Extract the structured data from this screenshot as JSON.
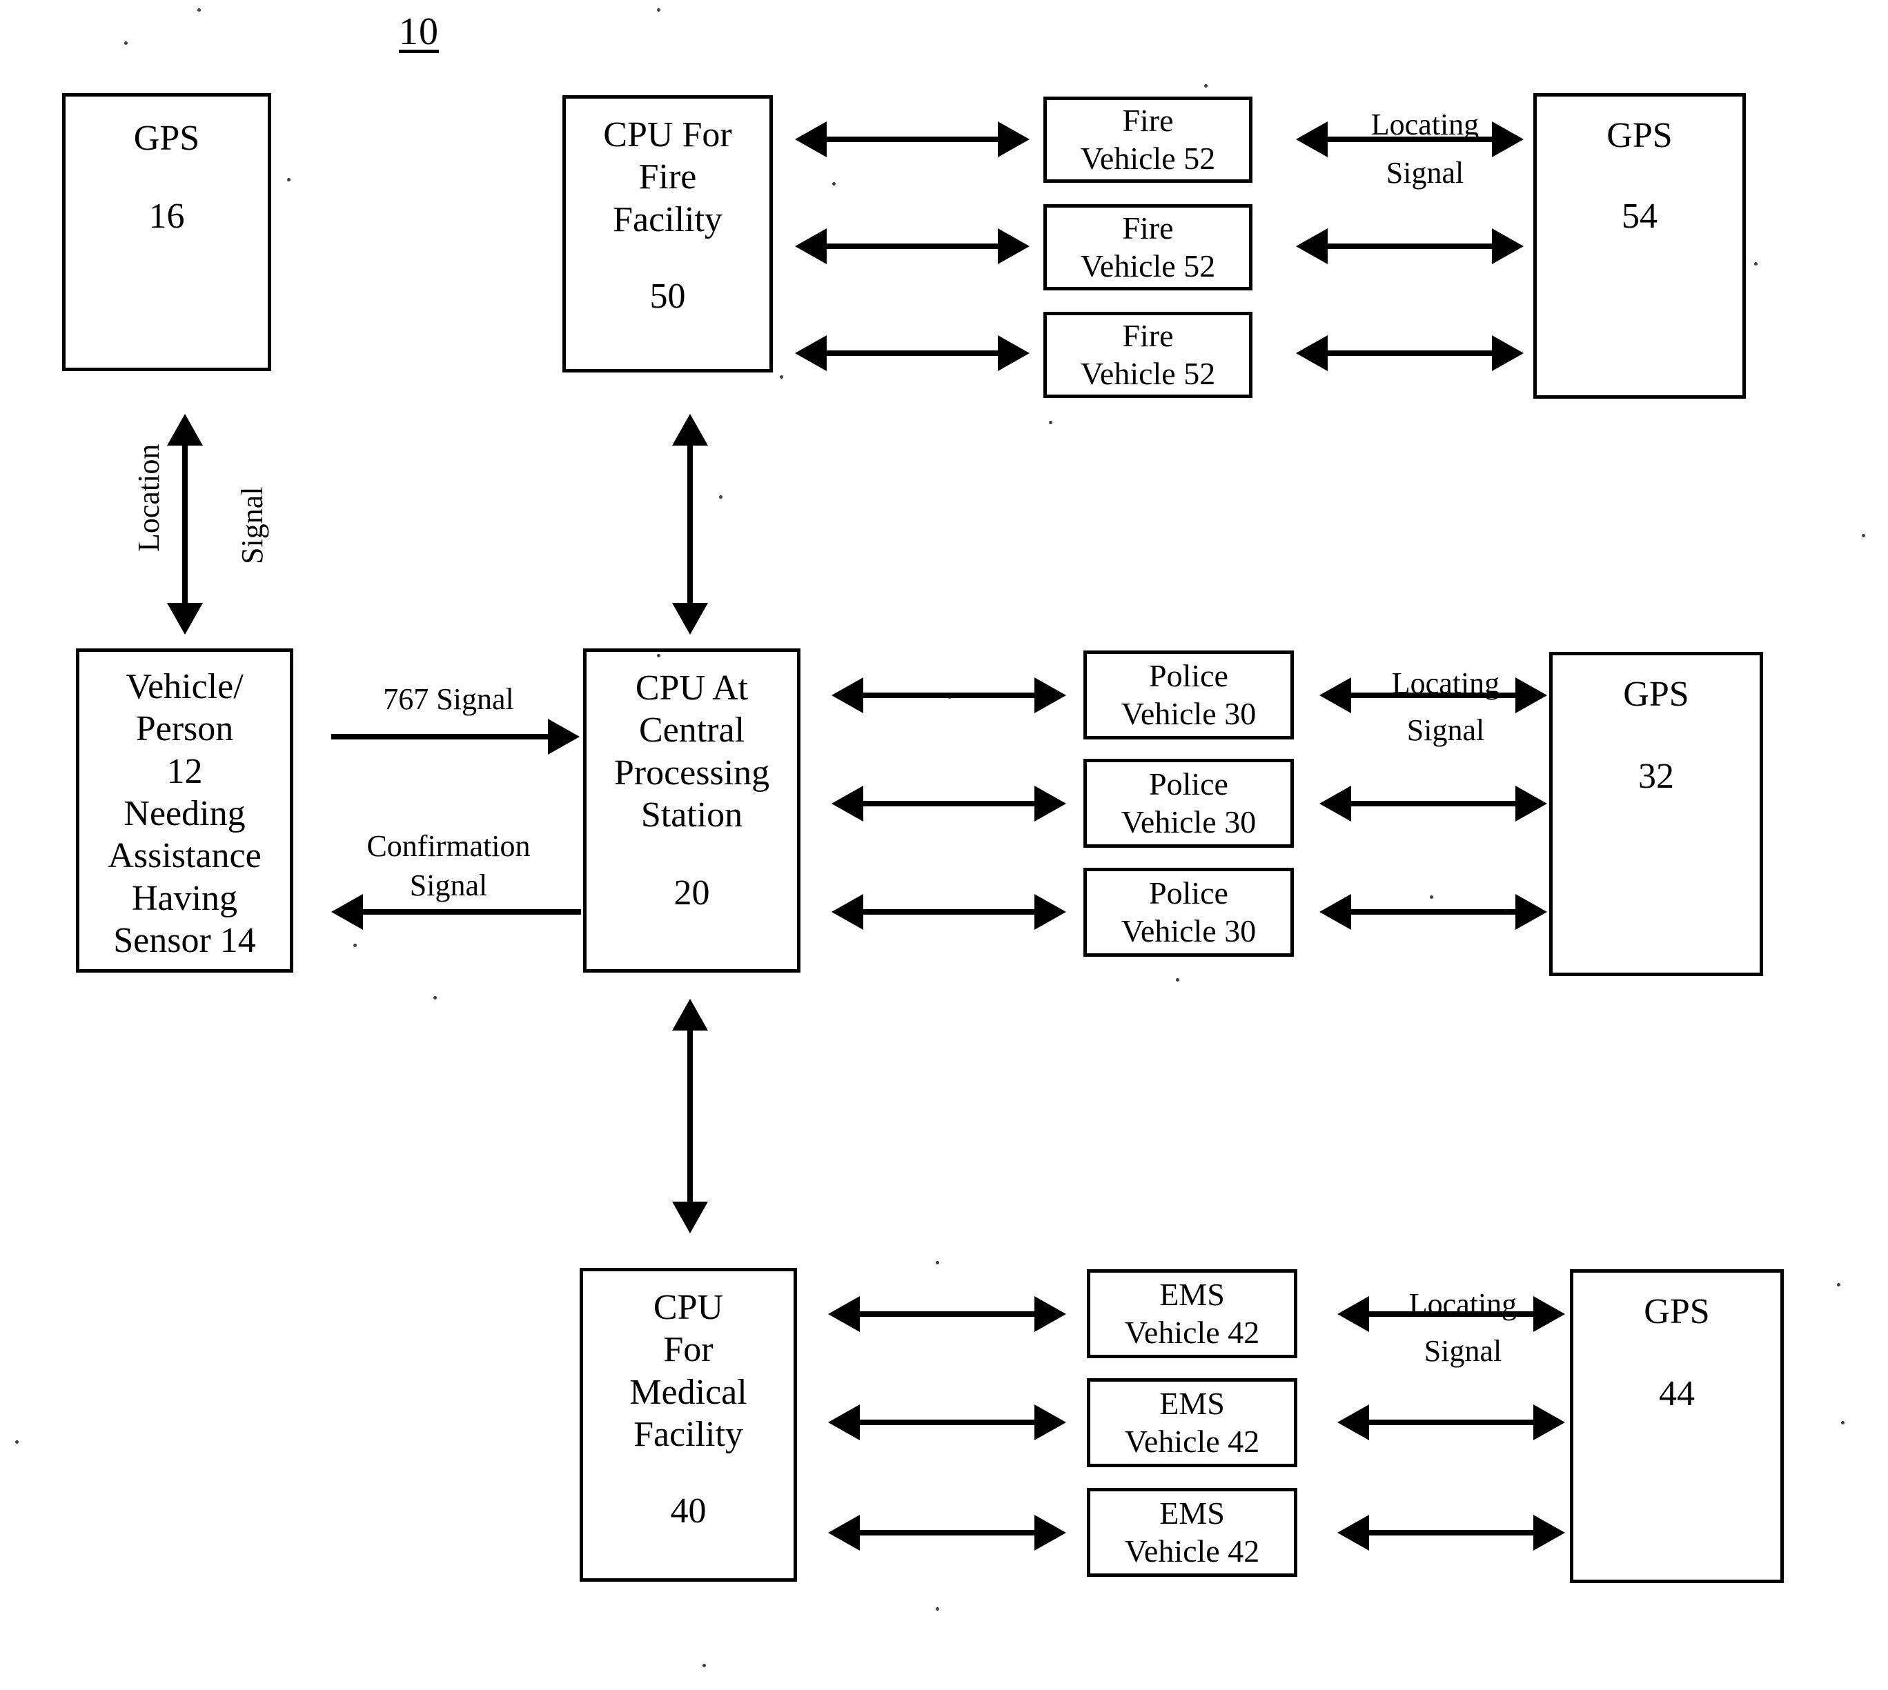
{
  "figure": {
    "number": "10"
  },
  "boxes": {
    "gps16": {
      "line1": "GPS",
      "line2": "16"
    },
    "cpu_fire": {
      "line1": "CPU For",
      "line2": "Fire",
      "line3": "Facility",
      "line4": "50"
    },
    "fire_vehicles": [
      {
        "line1": "Fire",
        "line2": "Vehicle 52"
      },
      {
        "line1": "Fire",
        "line2": "Vehicle 52"
      },
      {
        "line1": "Fire",
        "line2": "Vehicle 52"
      }
    ],
    "gps54": {
      "line1": "GPS",
      "line2": "54"
    },
    "vehicle_person": {
      "line1": "Vehicle/",
      "line2": "Person",
      "line3": "12",
      "line4": "Needing",
      "line5": "Assistance",
      "line6": "Having",
      "line7": "Sensor 14"
    },
    "cpu_central": {
      "line1": "CPU At",
      "line2": "Central",
      "line3": "Processing",
      "line4": "Station",
      "line5": "20"
    },
    "police_vehicles": [
      {
        "line1": "Police",
        "line2": "Vehicle 30"
      },
      {
        "line1": "Police",
        "line2": "Vehicle 30"
      },
      {
        "line1": "Police",
        "line2": "Vehicle 30"
      }
    ],
    "gps32": {
      "line1": "GPS",
      "line2": "32"
    },
    "cpu_medical": {
      "line1": "CPU",
      "line2": "For",
      "line3": "Medical",
      "line4": "Facility",
      "line5": "40"
    },
    "ems_vehicles": [
      {
        "line1": "EMS",
        "line2": "Vehicle 42"
      },
      {
        "line1": "EMS",
        "line2": "Vehicle 42"
      },
      {
        "line1": "EMS",
        "line2": "Vehicle 42"
      }
    ],
    "gps44": {
      "line1": "GPS",
      "line2": "44"
    }
  },
  "labels": {
    "location": "Location",
    "signal": "Signal",
    "signal_767": "767 Signal",
    "confirmation_line1": "Confirmation",
    "confirmation_line2": "Signal",
    "locating_fire_line1": "Locating",
    "locating_fire_line2": "Signal",
    "locating_police_line1": "Locating",
    "locating_police_line2": "Signal",
    "locating_ems_line1": "Locating",
    "locating_ems_line2": "Signal"
  },
  "colors": {
    "ink": "#000000",
    "paper": "#ffffff"
  }
}
